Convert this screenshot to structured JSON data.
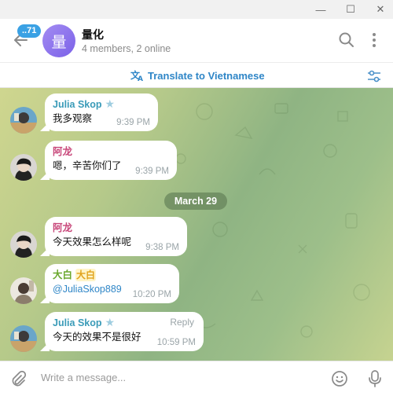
{
  "window": {
    "minimize_glyph": "—",
    "maximize_glyph": "☐",
    "close_glyph": "✕"
  },
  "header": {
    "unread_count": "..71",
    "avatar_letter": "量",
    "title": "量化",
    "subtitle": "4 members, 2 online",
    "icons": [
      "back-arrow-icon",
      "search-icon",
      "more-vertical-icon"
    ]
  },
  "translate_bar": {
    "label": "Translate to Vietnamese",
    "icon": "translate-icon",
    "settings_icon": "sliders-icon"
  },
  "chat": {
    "date_separator": "March 29",
    "messages": [
      {
        "sender": "Julia Skop",
        "badge": "★",
        "text": "我多观察",
        "time": "9:39 PM",
        "color": "#3a9bb8"
      },
      {
        "sender": "阿龙",
        "text": "嗯，辛苦你们了",
        "time": "9:39 PM",
        "color": "#c8477a"
      },
      {
        "sender": "阿龙",
        "text": "今天效果怎么样呢",
        "time": "9:38 PM",
        "color": "#c8477a"
      },
      {
        "sender": "大白",
        "badge": "大白",
        "text": "@JuliaSkop889",
        "time": "10:20 PM",
        "color": "#6ba82e"
      },
      {
        "sender": "Julia Skop",
        "badge": "★",
        "reply": "Reply",
        "text": "今天的效果不是很好",
        "time": "10:59 PM",
        "color": "#3a9bb8"
      }
    ]
  },
  "composer": {
    "placeholder": "Write a message...",
    "icons": [
      "paperclip-icon",
      "emoji-icon",
      "microphone-icon"
    ]
  },
  "colors": {
    "accent": "#2f86c7",
    "badge": "#3aa1e4",
    "julia_name": "#3a9bb8",
    "along_name": "#c8477a",
    "dabai_name": "#6ba82e"
  }
}
